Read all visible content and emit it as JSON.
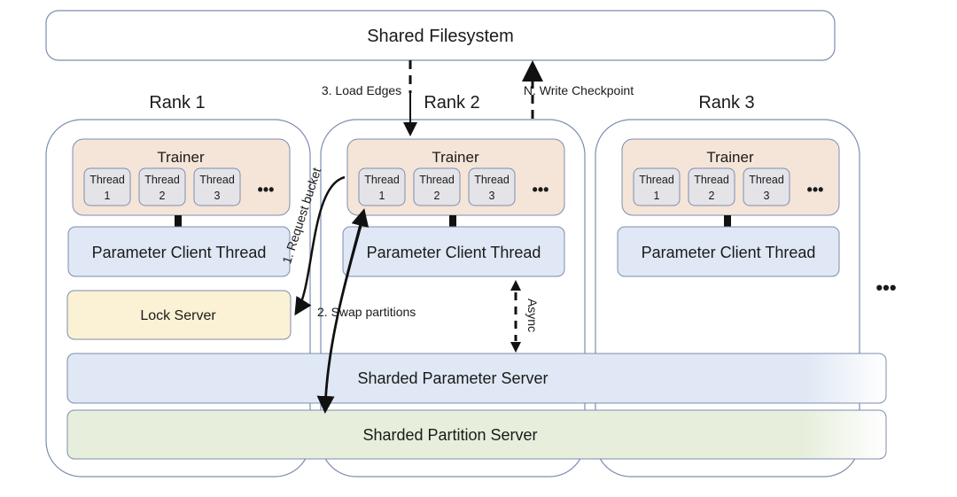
{
  "filesystem": {
    "label": "Shared Filesystem"
  },
  "ranks": [
    {
      "label": "Rank 1",
      "trainer": "Trainer",
      "threads": [
        [
          "Thread",
          "1"
        ],
        [
          "Thread",
          "2"
        ],
        [
          "Thread",
          "3"
        ]
      ],
      "more": "•••",
      "client": "Parameter Client Thread",
      "lock": "Lock Server"
    },
    {
      "label": "Rank 2",
      "trainer": "Trainer",
      "threads": [
        [
          "Thread",
          "1"
        ],
        [
          "Thread",
          "2"
        ],
        [
          "Thread",
          "3"
        ]
      ],
      "more": "•••",
      "client": "Parameter Client Thread"
    },
    {
      "label": "Rank 3",
      "trainer": "Trainer",
      "threads": [
        [
          "Thread",
          "1"
        ],
        [
          "Thread",
          "2"
        ],
        [
          "Thread",
          "3"
        ]
      ],
      "more": "•••",
      "client": "Parameter Client Thread"
    }
  ],
  "more_ranks": "•••",
  "parameter_server": "Sharded Parameter Server",
  "partition_server": "Sharded Partition Server",
  "edges": {
    "request_bucket": "1. Request bucket",
    "swap_partitions": "2. Swap partitions",
    "load_edges": "3. Load Edges",
    "write_checkpoint": "N. Write Checkpoint",
    "async": "Async"
  },
  "colors": {
    "border": "#7d8db0",
    "trainer": "#f5e5d8",
    "thread": "#e4e4e8",
    "client": "#dfe8f4",
    "lock": "#fbf1d4",
    "partition": "#e7efdc"
  }
}
